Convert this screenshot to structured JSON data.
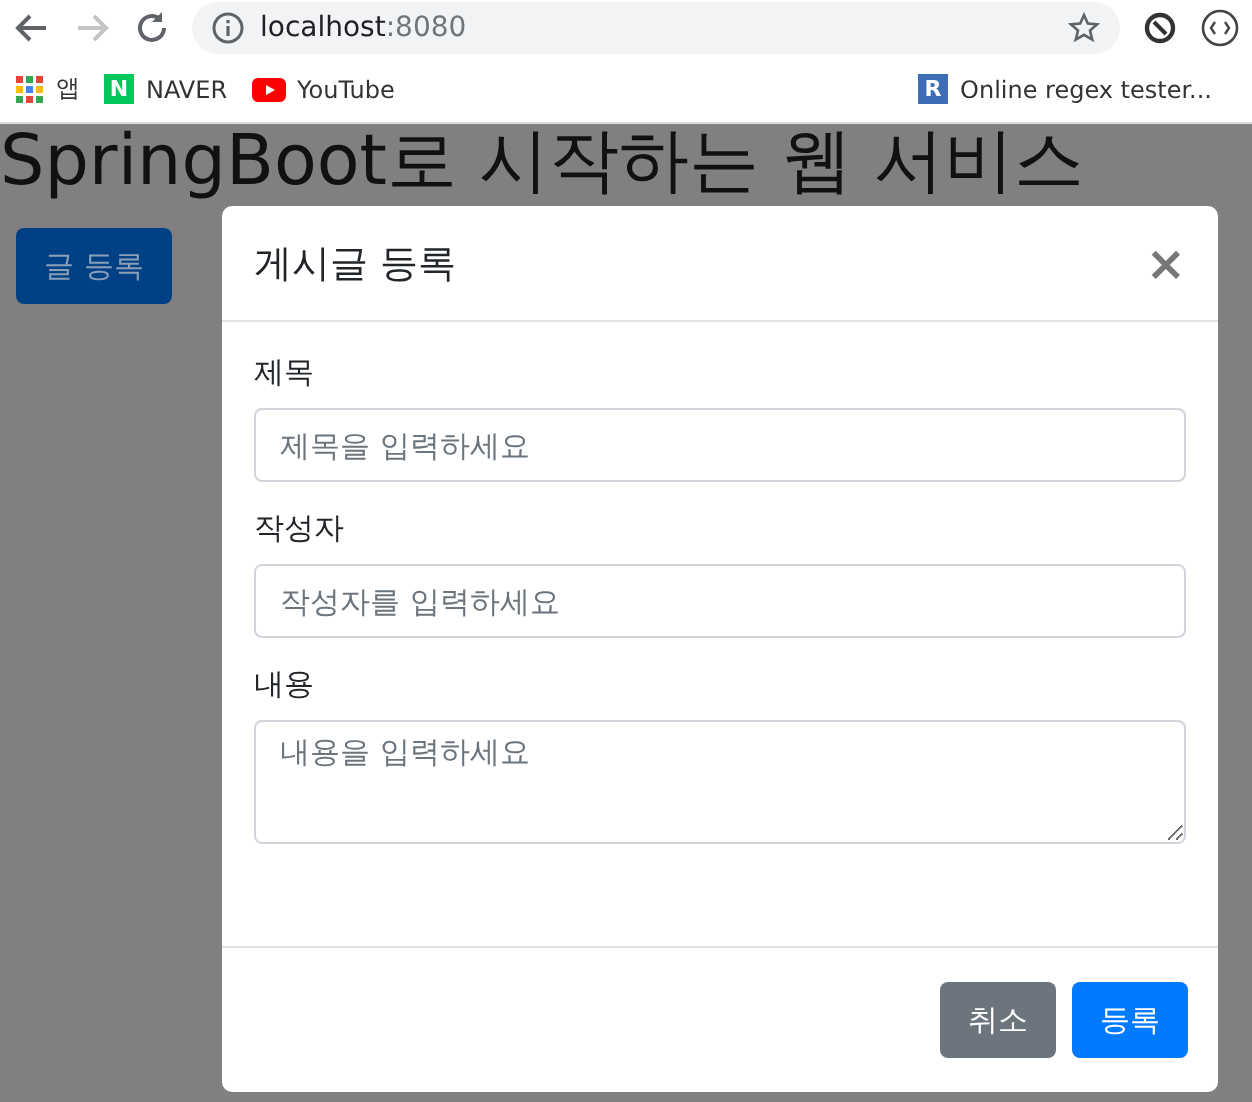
{
  "browser": {
    "url_host": "localhost",
    "url_port": ":8080",
    "forward_disabled": true
  },
  "bookmarks": [
    {
      "kind": "apps",
      "label": "앱"
    },
    {
      "kind": "letter",
      "badge": "N",
      "color": "#03c75a",
      "label": "NAVER"
    },
    {
      "kind": "video",
      "label": "YouTube"
    },
    {
      "kind": "letter",
      "badge": "R",
      "color": "#3d6db5",
      "label": "Online regex tester..."
    }
  ],
  "page": {
    "heading": "SpringBoot로 시작하는 웹 서비스",
    "button": "글 등록"
  },
  "modal": {
    "title": "게시글 등록",
    "close": "×",
    "fields": [
      {
        "kind": "input",
        "label": "제목",
        "placeholder": "제목을 입력하세요"
      },
      {
        "kind": "input",
        "label": "작성자",
        "placeholder": "작성자를 입력하세요"
      },
      {
        "kind": "textarea",
        "label": "내용",
        "placeholder": "내용을 입력하세요"
      }
    ],
    "buttons": [
      {
        "kind": "secondary",
        "label": "취소"
      },
      {
        "kind": "primary",
        "label": "등록"
      }
    ]
  }
}
